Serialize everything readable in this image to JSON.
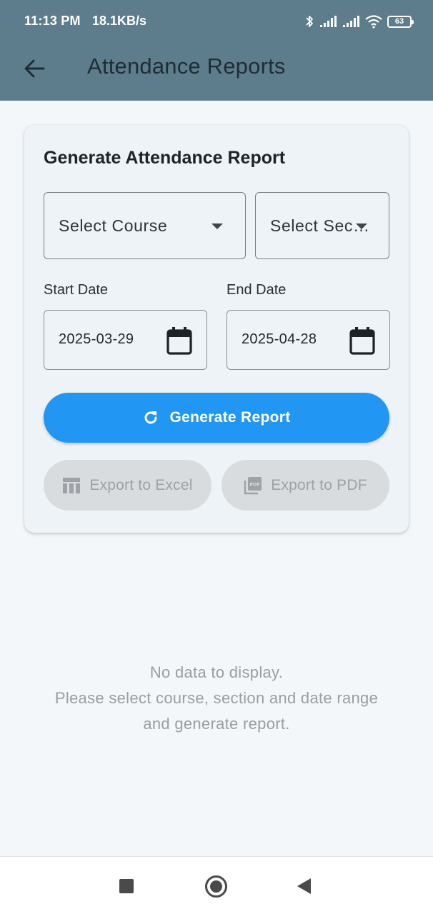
{
  "status_bar": {
    "time": "11:13 PM",
    "speed": "18.1KB/s",
    "battery": "63",
    "icons": [
      "bluetooth-icon",
      "signal-icon",
      "signal-icon",
      "wifi-icon",
      "battery-icon"
    ]
  },
  "app_bar": {
    "title": "Attendance Reports",
    "back_icon": "arrow-left-icon",
    "color": "#5e7d8c"
  },
  "card": {
    "title": "Generate Attendance Report",
    "course_select": {
      "value": "Select Course"
    },
    "section_select": {
      "value": "Select Sec…"
    },
    "start_date": {
      "label": "Start Date",
      "value": "2025-03-29"
    },
    "end_date": {
      "label": "End Date",
      "value": "2025-04-28"
    },
    "generate_button": {
      "label": "Generate Report",
      "icon": "refresh-icon",
      "color": "#2196f3"
    },
    "export_excel": {
      "label": "Export to Excel",
      "icon": "table-icon"
    },
    "export_pdf": {
      "label": "Export to PDF",
      "icon": "pdf-icon"
    }
  },
  "empty_state": {
    "line1": "No data to display.",
    "line2": "Please select course, section and date range",
    "line3": "and generate report."
  },
  "nav_bar": {
    "items": [
      "recents-button",
      "home-button",
      "back-button"
    ]
  }
}
